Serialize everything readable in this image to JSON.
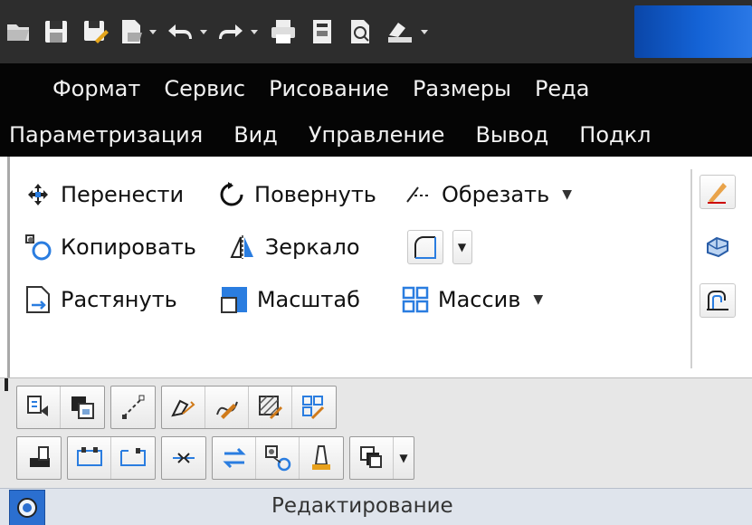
{
  "quick_access": {
    "icons": [
      "open-icon",
      "save-icon",
      "save-as-icon",
      "plot-preview-icon",
      "undo-icon",
      "redo-icon",
      "print-icon",
      "publish-icon",
      "preview-icon",
      "plot-icon"
    ]
  },
  "menubar_top": {
    "items": [
      "Формат",
      "Сервис",
      "Рисование",
      "Размеры",
      "Реда"
    ]
  },
  "menubar_tabs": {
    "items": [
      "Параметризация",
      "Вид",
      "Управление",
      "Вывод",
      "Подкл"
    ]
  },
  "ribbon": {
    "row1": {
      "move": "Перенести",
      "rotate": "Повернуть",
      "trim": "Обрезать"
    },
    "row2": {
      "copy": "Копировать",
      "mirror": "Зеркало"
    },
    "row3": {
      "stretch": "Растянуть",
      "scale": "Масштаб",
      "array": "Массив"
    }
  },
  "panel": {
    "title": "Редактирование"
  },
  "colors": {
    "menubar_bg": "#050505",
    "menubar_fg": "#f2f2f2",
    "accent_blue": "#1463d6",
    "panel_bg": "#e7e7e7"
  }
}
